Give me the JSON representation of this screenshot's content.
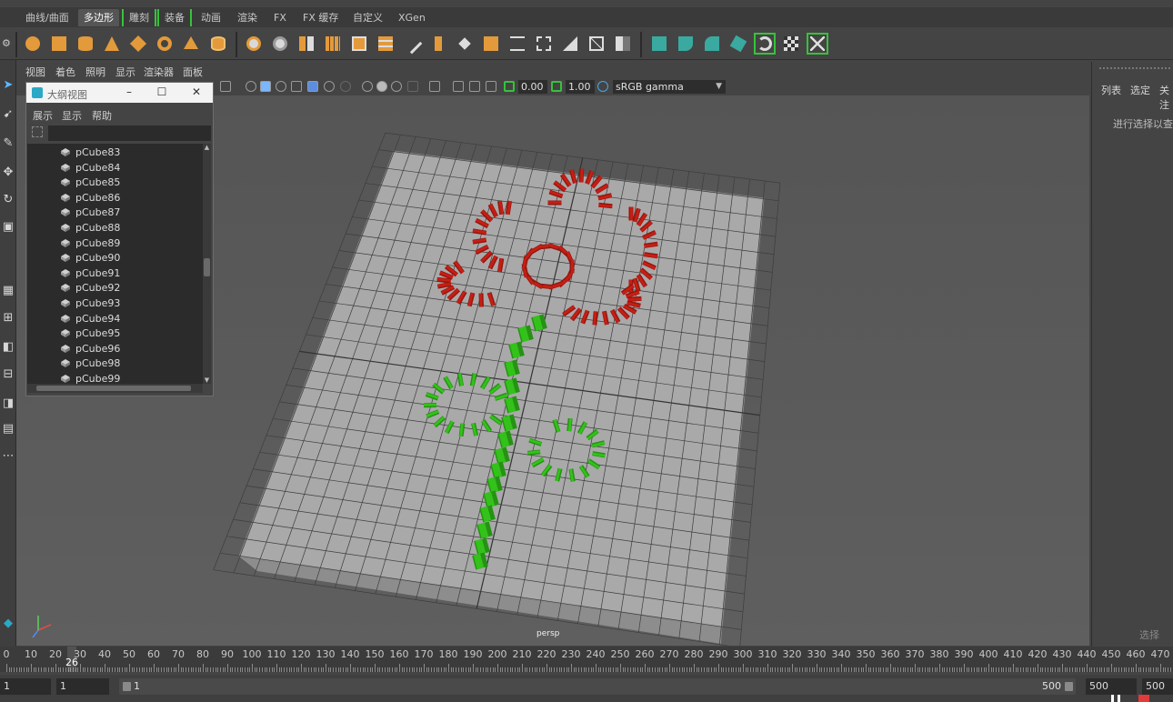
{
  "shelf_tabs": [
    "曲线/曲面",
    "多边形",
    "雕刻",
    "装备",
    "动画",
    "渲染",
    "FX",
    "FX 缓存",
    "自定义",
    "XGen"
  ],
  "shelf_active": "多边形",
  "panel_menu": [
    "视图",
    "着色",
    "照明",
    "显示",
    "渲染器",
    "面板"
  ],
  "panel_toolbar": {
    "exposure": "0.00",
    "gamma": "1.00",
    "colorspace": "sRGB gamma"
  },
  "outliner": {
    "title": "大纲视图",
    "menu": [
      "展示",
      "显示",
      "帮助"
    ],
    "items": [
      "pCube83",
      "pCube84",
      "pCube85",
      "pCube86",
      "pCube87",
      "pCube88",
      "pCube89",
      "pCube90",
      "pCube91",
      "pCube92",
      "pCube93",
      "pCube94",
      "pCube95",
      "pCube96",
      "pCube98",
      "pCube99"
    ]
  },
  "viewport": {
    "camera_label": "persp"
  },
  "right_panel": {
    "menu": [
      "列表",
      "选定",
      "关注"
    ],
    "hint": "进行选择以查看",
    "footer": "选择"
  },
  "timeline": {
    "ticks": [
      "0",
      "10",
      "20",
      "30",
      "40",
      "50",
      "60",
      "70",
      "80",
      "90",
      "100",
      "110",
      "120",
      "130",
      "140",
      "150",
      "160",
      "170",
      "180",
      "190",
      "200",
      "210",
      "220",
      "230",
      "240",
      "250",
      "260",
      "270",
      "280",
      "290",
      "300",
      "310",
      "320",
      "330",
      "340",
      "350",
      "360",
      "370",
      "380",
      "390",
      "400",
      "410",
      "420",
      "430",
      "440",
      "450",
      "460",
      "470"
    ],
    "current_frame": "26"
  },
  "range": {
    "start": "1",
    "playback_start": "1",
    "slider_start": "1",
    "slider_end": "500",
    "playback_end": "500",
    "end": "500"
  },
  "colors": {
    "flower_red": "#c81e14",
    "stem_green": "#33c21a",
    "plane_gray": "#a9a9a9",
    "accent_green": "#37c23b",
    "shelf_orange": "#e39a3b"
  }
}
